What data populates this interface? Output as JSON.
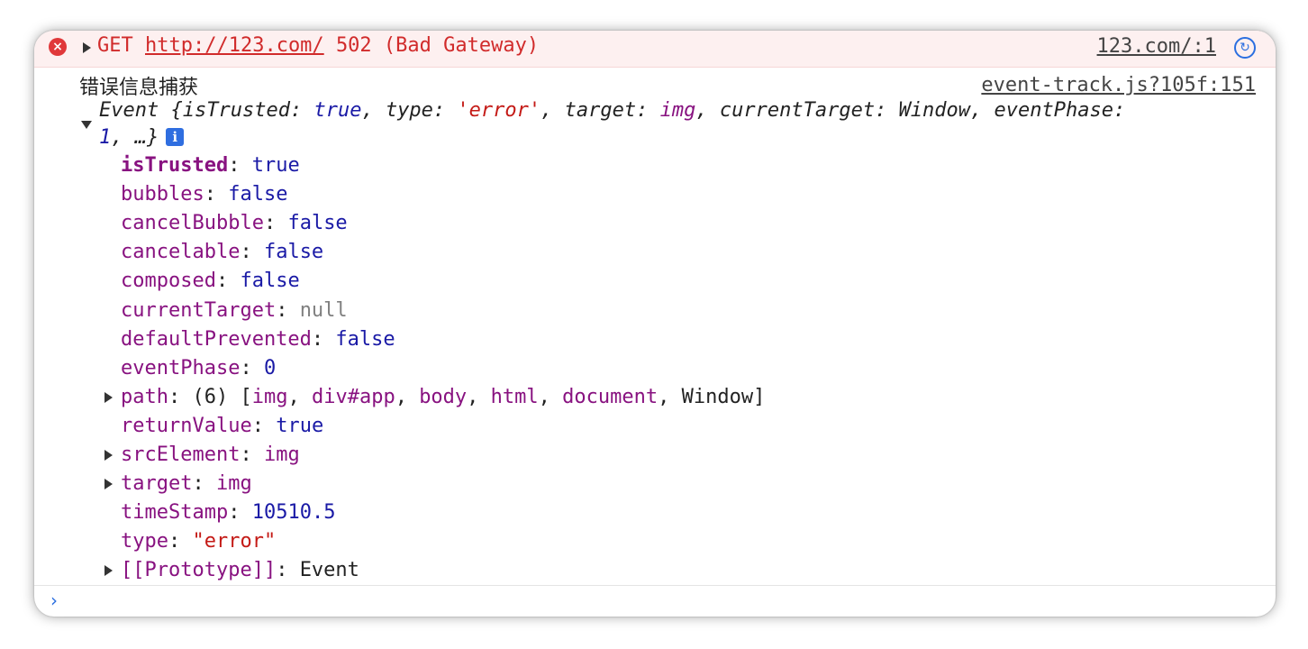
{
  "error_row": {
    "method": "GET",
    "url": "http://123.com/",
    "status": "502 (Bad Gateway)",
    "source": "123.com/:1"
  },
  "log": {
    "label": "错误信息捕获",
    "source": "event-track.js?105f:151"
  },
  "event_summary": {
    "type_name": "Event",
    "brace_open": "{",
    "p1_key": "isTrusted",
    "p1_val": "true",
    "p2_key": "type",
    "p2_val": "'error'",
    "p3_key": "target",
    "p3_val": "img",
    "p4_key": "currentTarget",
    "p4_val": "Window",
    "p5_key": "eventPhase",
    "p5_val": "1",
    "ellipsis": "…}",
    "info_badge": "i"
  },
  "properties": [
    {
      "key": "isTrusted",
      "value": "true",
      "expandable": false,
      "kind": "bool",
      "bold": true
    },
    {
      "key": "bubbles",
      "value": "false",
      "expandable": false,
      "kind": "bool"
    },
    {
      "key": "cancelBubble",
      "value": "false",
      "expandable": false,
      "kind": "bool"
    },
    {
      "key": "cancelable",
      "value": "false",
      "expandable": false,
      "kind": "bool"
    },
    {
      "key": "composed",
      "value": "false",
      "expandable": false,
      "kind": "bool"
    },
    {
      "key": "currentTarget",
      "value": "null",
      "expandable": false,
      "kind": "null"
    },
    {
      "key": "defaultPrevented",
      "value": "false",
      "expandable": false,
      "kind": "bool"
    },
    {
      "key": "eventPhase",
      "value": "0",
      "expandable": false,
      "kind": "num"
    },
    {
      "key": "path",
      "value_prefix": "(6) [",
      "items": [
        "img",
        "div#app",
        "body",
        "html",
        "document",
        "Window"
      ],
      "value_suffix": "]",
      "expandable": true,
      "kind": "array"
    },
    {
      "key": "returnValue",
      "value": "true",
      "expandable": false,
      "kind": "bool"
    },
    {
      "key": "srcElement",
      "value": "img",
      "expandable": true,
      "kind": "tag"
    },
    {
      "key": "target",
      "value": "img",
      "expandable": true,
      "kind": "tag"
    },
    {
      "key": "timeStamp",
      "value": "10510.5",
      "expandable": false,
      "kind": "num"
    },
    {
      "key": "type",
      "value": "\"error\"",
      "expandable": false,
      "kind": "str"
    },
    {
      "key": "[[Prototype]]",
      "value": "Event",
      "expandable": true,
      "kind": "obj"
    }
  ],
  "prompt": {
    "caret": "›"
  },
  "colors": {
    "error_bg": "#fdf0f0",
    "error_text": "#d12b2b",
    "key": "#881280",
    "bool": "#1a1aa6",
    "string": "#c41a16",
    "null": "#808080",
    "accent": "#2b6fe0"
  }
}
